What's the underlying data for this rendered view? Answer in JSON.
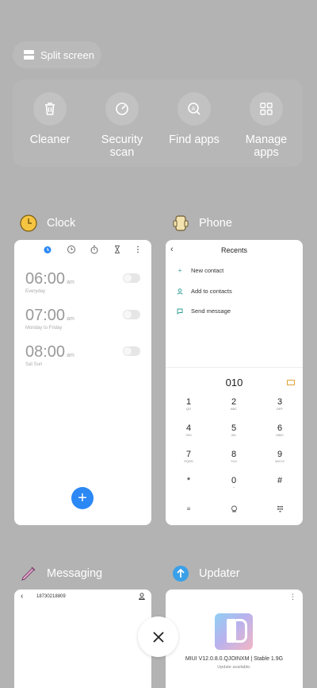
{
  "split_screen": {
    "label": "Split screen"
  },
  "tools": [
    {
      "label": "Cleaner",
      "icon": "trash-icon"
    },
    {
      "label": "Security\nscan",
      "icon": "shield-check-icon"
    },
    {
      "label": "Find apps",
      "icon": "app-search-icon"
    },
    {
      "label": "Manage\napps",
      "icon": "grid-icon"
    }
  ],
  "apps": {
    "clock": {
      "name": "Clock",
      "icon": "clock-app-icon",
      "alarms": [
        {
          "time": "06:00",
          "ampm": "am",
          "repeat": "Everyday"
        },
        {
          "time": "07:00",
          "ampm": "am",
          "repeat": "Monday to Friday"
        },
        {
          "time": "08:00",
          "ampm": "am",
          "repeat": "Sat Sun"
        }
      ],
      "fab": "+"
    },
    "phone": {
      "name": "Phone",
      "icon": "phone-app-icon",
      "title": "Recents",
      "options": [
        "New contact",
        "Add to contacts",
        "Send message"
      ],
      "dialed": "010",
      "keys": [
        {
          "d": "1",
          "l": "QO"
        },
        {
          "d": "2",
          "l": "ABC"
        },
        {
          "d": "3",
          "l": "DEF"
        },
        {
          "d": "4",
          "l": "GHI"
        },
        {
          "d": "5",
          "l": "JKL"
        },
        {
          "d": "6",
          "l": "MNO"
        },
        {
          "d": "7",
          "l": "PQRS"
        },
        {
          "d": "8",
          "l": "TUV"
        },
        {
          "d": "9",
          "l": "WXYZ"
        },
        {
          "d": "*",
          "l": ""
        },
        {
          "d": "0",
          "l": "+"
        },
        {
          "d": "#",
          "l": ""
        }
      ]
    },
    "messaging": {
      "name": "Messaging",
      "icon": "messaging-app-icon",
      "number": "18730218809"
    },
    "updater": {
      "name": "Updater",
      "icon": "updater-app-icon",
      "version": "MIUI V12.0.8.0.QJOINXM | Stable 1.9G",
      "status": "Update available."
    }
  },
  "colors": {
    "background": "#b3b3b3",
    "accent": "#2b88f5"
  }
}
